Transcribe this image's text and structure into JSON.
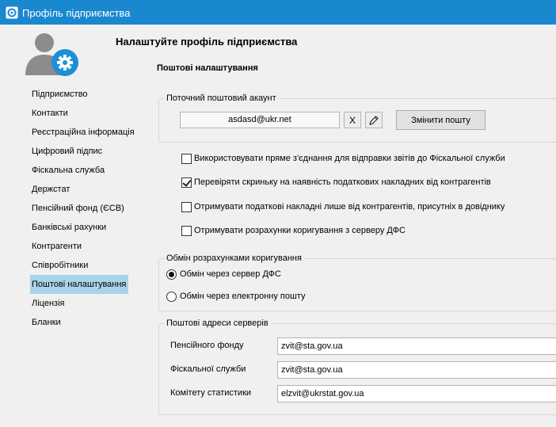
{
  "window": {
    "title": "Профіль підприємства"
  },
  "header": {
    "title": "Налаштуйте профіль підприємства",
    "section": "Поштові налаштування"
  },
  "sidebar": {
    "items": [
      {
        "label": "Підприємство"
      },
      {
        "label": "Контакти"
      },
      {
        "label": "Реєстраційна інформація"
      },
      {
        "label": "Цифровий підпис"
      },
      {
        "label": "Фіскальна служба"
      },
      {
        "label": "Держстат"
      },
      {
        "label": "Пенсійний фонд (ЄСВ)"
      },
      {
        "label": "Банківські рахунки"
      },
      {
        "label": "Контрагенти"
      },
      {
        "label": "Співробітники"
      },
      {
        "label": "Поштові налаштування",
        "active": true
      },
      {
        "label": "Ліцензія"
      },
      {
        "label": "Бланки"
      }
    ]
  },
  "account": {
    "legend": "Поточний поштовий акаунт",
    "email": "asdasd@ukr.net",
    "clear_label": "X",
    "change_label": "Змінити пошту"
  },
  "options": [
    {
      "label": "Використовувати пряме з'єднання для відправки звітів до Фіскальної служби",
      "checked": false
    },
    {
      "label": "Перевіряти скриньку на наявність податкових накладних від контрагентів",
      "checked": true
    },
    {
      "label": "Отримувати податкові накладні лише від контрагентів, присутніх в довіднику",
      "checked": false
    },
    {
      "label": "Отримувати розрахунки коригування з серверу ДФС",
      "checked": false
    }
  ],
  "exchange": {
    "legend": "Обмін розрахунками коригування",
    "options": [
      {
        "label": "Обмін через сервер ДФС",
        "selected": true
      },
      {
        "label": "Обмін через електронну пошту",
        "selected": false
      }
    ]
  },
  "servers": {
    "legend": "Поштові адреси серверів",
    "rows": [
      {
        "label": "Пенсійного фонду",
        "value": "zvit@sta.gov.ua"
      },
      {
        "label": "Фіскальної служби",
        "value": "zvit@sta.gov.ua"
      },
      {
        "label": "Комітету статистики",
        "value": "elzvit@ukrstat.gov.ua"
      }
    ]
  },
  "colors": {
    "titlebar": "#1a88cf",
    "nav_active": "#a8d3ea",
    "avatar_gear": "#1d8fd5"
  }
}
